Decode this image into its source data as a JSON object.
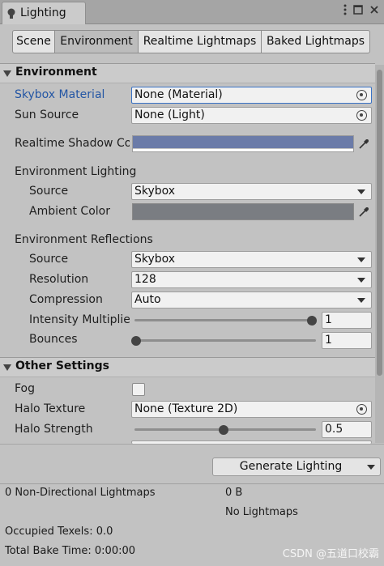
{
  "window": {
    "tab_title": "Lighting",
    "tab_icon": "lightbulb-icon",
    "menu_icon": "kebab-menu-icon",
    "maximize_icon": "maximize-icon",
    "close_icon": "close-icon"
  },
  "subtabs": [
    "Scene",
    "Environment",
    "Realtime Lightmaps",
    "Baked Lightmaps"
  ],
  "active_subtab": "Environment",
  "environment": {
    "header": "Environment",
    "skybox_material": {
      "label": "Skybox Material",
      "value": "None (Material)"
    },
    "sun_source": {
      "label": "Sun Source",
      "value": "None (Light)"
    },
    "realtime_shadow_color": {
      "label": "Realtime Shadow Co",
      "color": "#6b7ba8"
    },
    "lighting": {
      "heading": "Environment Lighting",
      "source": {
        "label": "Source",
        "value": "Skybox"
      },
      "ambient_color": {
        "label": "Ambient Color",
        "color": "#7a7d82"
      }
    },
    "reflections": {
      "heading": "Environment Reflections",
      "source": {
        "label": "Source",
        "value": "Skybox"
      },
      "resolution": {
        "label": "Resolution",
        "value": "128"
      },
      "compression": {
        "label": "Compression",
        "value": "Auto"
      },
      "intensity_multiplier": {
        "label": "Intensity Multiplie",
        "value": "1",
        "slider_fraction": 1.0
      },
      "bounces": {
        "label": "Bounces",
        "value": "1",
        "slider_fraction": 0.0
      }
    }
  },
  "other_settings": {
    "header": "Other Settings",
    "fog": {
      "label": "Fog",
      "checked": false
    },
    "halo_texture": {
      "label": "Halo Texture",
      "value": "None (Texture 2D)"
    },
    "halo_strength": {
      "label": "Halo Strength",
      "value": "0.5",
      "slider_fraction": 0.5
    }
  },
  "generate_button": "Generate Lighting",
  "stats": {
    "non_directional": "0 Non-Directional Lightmaps",
    "size": "0 B",
    "no_lightmaps": "No Lightmaps",
    "occupied_texels": "Occupied Texels: 0.0",
    "total_bake_time": "Total Bake Time: 0:00:00"
  },
  "watermark": "CSDN @五道口校霸",
  "colors": {
    "selected_border": "#3a72c4",
    "selected_label": "#2456a4"
  }
}
